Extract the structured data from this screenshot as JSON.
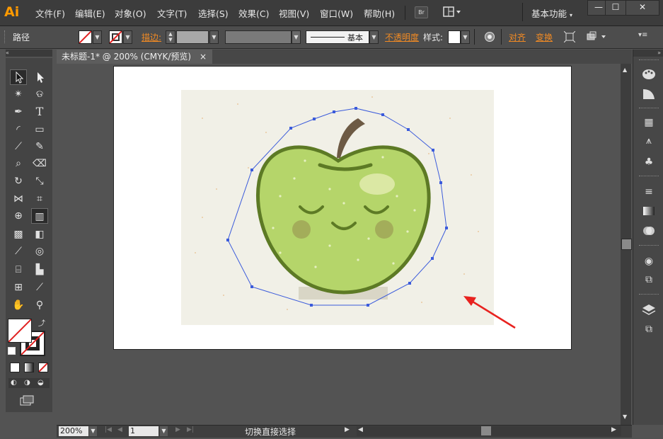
{
  "app": {
    "logo": "Ai"
  },
  "menu": [
    "文件(F)",
    "编辑(E)",
    "对象(O)",
    "文字(T)",
    "选择(S)",
    "效果(C)",
    "视图(V)",
    "窗口(W)",
    "帮助(H)"
  ],
  "toolbar_icons": {
    "bridge": "Br",
    "arrange_icon": "arrange-docs-icon"
  },
  "workspace": {
    "label": "基本功能"
  },
  "window_controls": {
    "minimize": "—",
    "maximize": "☐",
    "close": "✕"
  },
  "control": {
    "selection_type": "路径",
    "stroke_label": "描边:",
    "stroke_line_label": "基本",
    "opacity_label": "不透明度",
    "style_label": "样式:",
    "align_label": "对齐",
    "transform_label": "变换"
  },
  "document": {
    "tab_title": "未标题-1* @ 200% (CMYK/预览)",
    "tab_close": "×"
  },
  "status": {
    "zoom": "200%",
    "page": "1",
    "status_text": "切换直接选择"
  },
  "colors": {
    "accent": "#f08a24",
    "path": "#3b5bdb",
    "arrow": "#e8221f",
    "apple_fill": "#b5d56a",
    "apple_stroke": "#5d7a25"
  }
}
